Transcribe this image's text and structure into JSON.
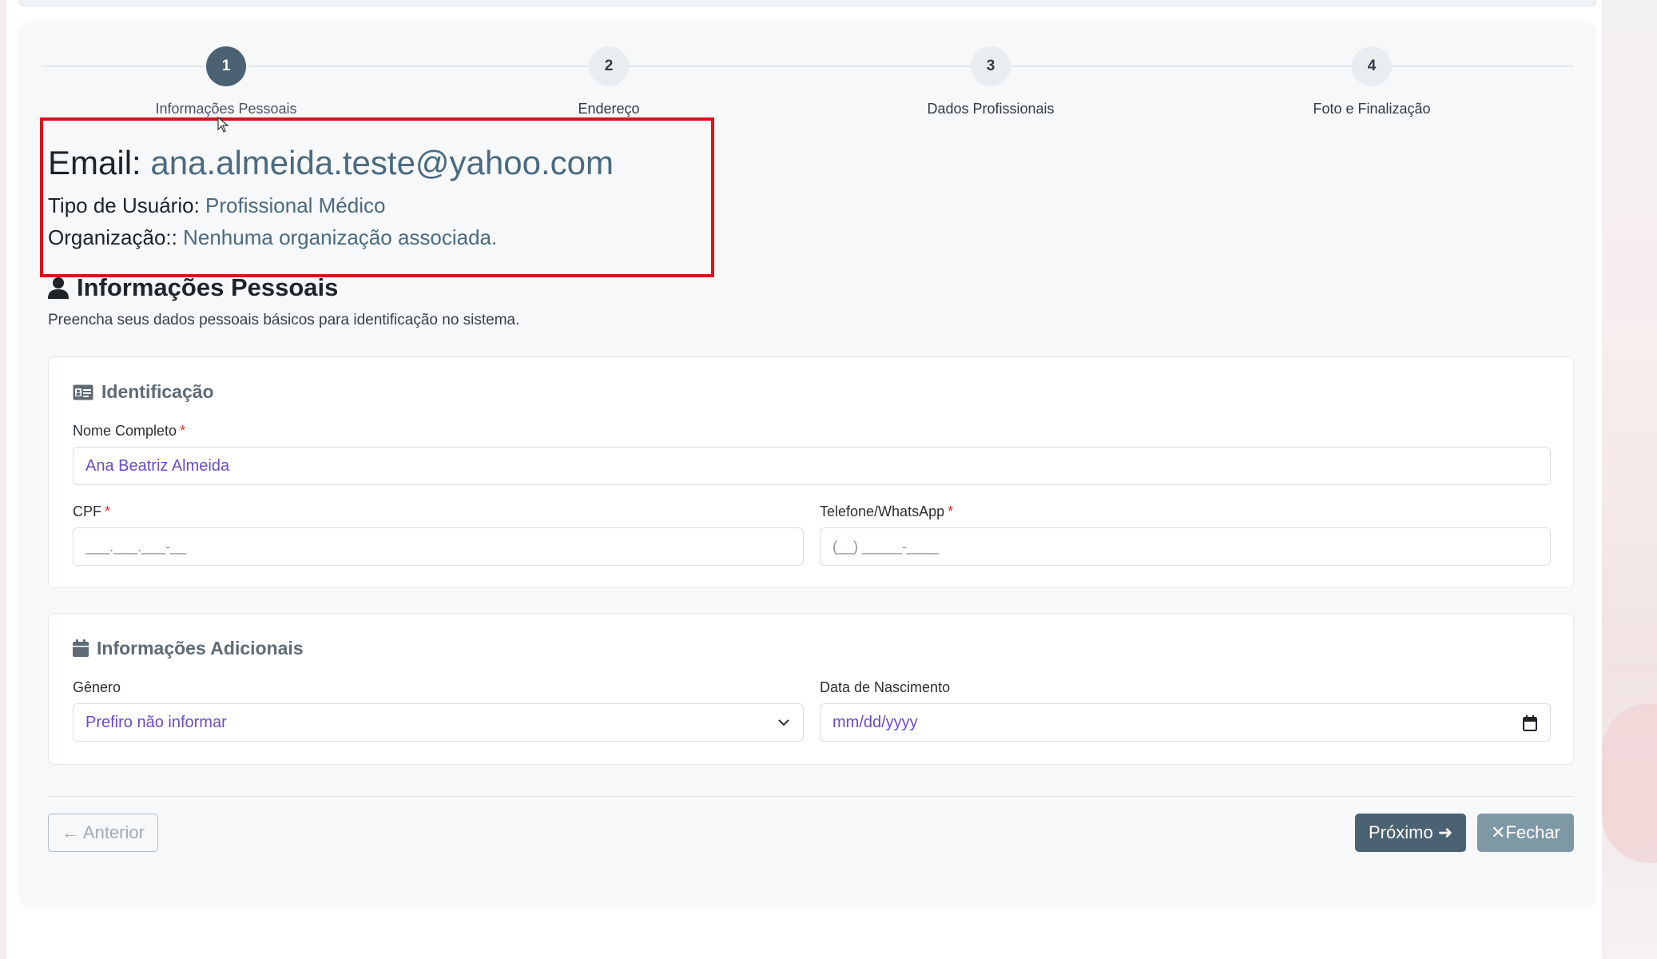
{
  "stepper": {
    "steps": [
      {
        "num": "1",
        "label": "Informações Pessoais"
      },
      {
        "num": "2",
        "label": "Endereço"
      },
      {
        "num": "3",
        "label": "Dados Profissionais"
      },
      {
        "num": "4",
        "label": "Foto e Finalização"
      }
    ],
    "active_step": 1
  },
  "user_info": {
    "email_label": "Email:",
    "email_value": "ana.almeida.teste@yahoo.com",
    "type_label": "Tipo de Usuário:",
    "type_value": "Profissional Médico",
    "org_label": "Organização::",
    "org_value": "Nenhuma organização associada."
  },
  "section": {
    "title": "Informações Pessoais",
    "description": "Preencha seus dados pessoais básicos para identificação no sistema."
  },
  "identificacao": {
    "title": "Identificação",
    "nome_label": "Nome Completo",
    "nome_value": "Ana Beatriz Almeida",
    "cpf_label": "CPF",
    "cpf_placeholder": "___.___.___-__",
    "telefone_label": "Telefone/WhatsApp",
    "telefone_placeholder": "(__) _____-____",
    "required_mark": "*"
  },
  "adicionais": {
    "title": "Informações Adicionais",
    "genero_label": "Gênero",
    "genero_value": "Prefiro não informar",
    "nascimento_label": "Data de Nascimento",
    "nascimento_placeholder": "mm/dd/yyyy"
  },
  "buttons": {
    "prev_label": "Anterior",
    "next_label": "Próximo",
    "close_label": "Fechar"
  },
  "colors": {
    "accent": "#4b6273",
    "highlight_border": "#d41519",
    "value_text": "#4b6a80",
    "input_text": "#6a4bc4"
  }
}
